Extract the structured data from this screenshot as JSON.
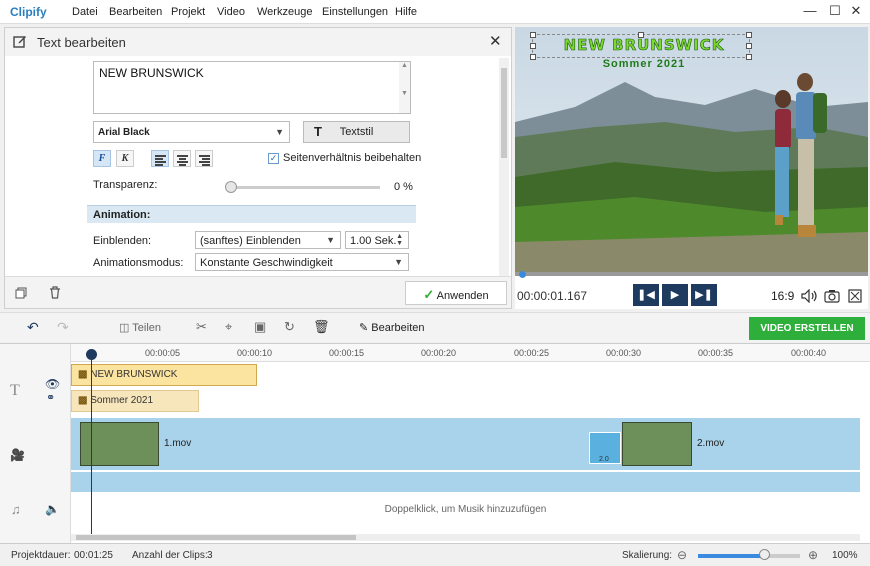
{
  "app": {
    "logo": "Clipify",
    "menu": [
      "Datei",
      "Bearbeiten",
      "Projekt",
      "Video",
      "Werkzeuge",
      "Einstellungen",
      "Hilfe"
    ]
  },
  "editor": {
    "title": "Text bearbeiten",
    "text_value": "NEW BRUNSWICK",
    "font": "Arial Black",
    "textstil_label": "Textstil",
    "bold_label": "F",
    "italic_label": "K",
    "keep_ratio_label": "Seitenverhältnis beibehalten",
    "keep_ratio_checked": true,
    "transparency_label": "Transparenz:",
    "transparency_value": "0 %",
    "transparency_level": 0,
    "animation_header": "Animation:",
    "einblenden_label": "Einblenden:",
    "einblenden_value": "(sanftes) Einblenden",
    "einblenden_seconds": "1.00 Sek.",
    "mode_label": "Animationsmodus:",
    "mode_value": "Konstante Geschwindigkeit",
    "apply_label": "Anwenden"
  },
  "preview": {
    "overlay_title": "NEW BRUNSWICK",
    "overlay_subtitle": "Sommer 2021",
    "timecode": "00:00:01.167",
    "aspect": "16:9"
  },
  "toolbar": {
    "split_label": "Teilen",
    "edit_label": "Bearbeiten",
    "create_label": "VIDEO ERSTELLEN"
  },
  "timeline": {
    "ticks": [
      "00:00:05",
      "00:00:10",
      "00:00:15",
      "00:00:20",
      "00:00:25",
      "00:00:30",
      "00:00:35",
      "00:00:40"
    ],
    "text_clip_1": "NEW BRUNSWICK",
    "text_clip_2": "Sommer 2021",
    "video_clip_1": "1.mov",
    "video_clip_2": "2.mov",
    "transition_duration": "2.0",
    "audio_hint": "Doppelklick, um Musik hinzuzufügen"
  },
  "status": {
    "duration_label": "Projektdauer:",
    "duration_value": "00:01:25",
    "clips_label": "Anzahl der Clips:",
    "clips_value": "3",
    "zoom_label": "Skalierung:",
    "zoom_value": "100%"
  },
  "colors": {
    "accent": "#2eae3a",
    "navy": "#1f3a5f",
    "track": "#a9d3ea",
    "text_clip": "#fbe3a0"
  }
}
